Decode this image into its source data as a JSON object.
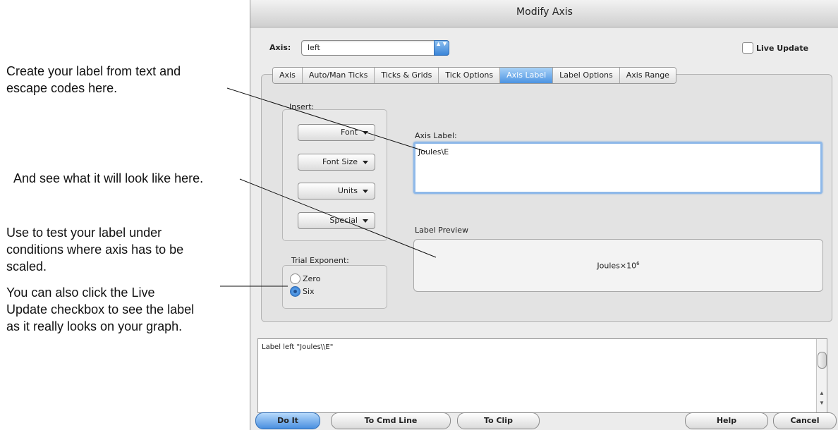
{
  "annotations": {
    "create_line1": "Create your label from text and",
    "create_line2": "escape codes here.",
    "see": "And see what it will look like here.",
    "use_line1": "Use to test your label under",
    "use_line2": "conditions where axis has to be",
    "use_line3": "scaled.",
    "live_line1": "You can also click the Live",
    "live_line2": "Update checkbox to see the label",
    "live_line3": "as it really looks on your graph."
  },
  "window": {
    "title": "Modify Axis"
  },
  "axis_selector": {
    "label": "Axis:",
    "value": "left",
    "arrows": "▲▼"
  },
  "live_update": {
    "label": "Live Update",
    "checked": false
  },
  "tabs": [
    {
      "label": "Axis"
    },
    {
      "label": "Auto/Man Ticks"
    },
    {
      "label": "Ticks & Grids"
    },
    {
      "label": "Tick Options"
    },
    {
      "label": "Axis Label",
      "selected": true
    },
    {
      "label": "Label Options"
    },
    {
      "label": "Axis Range"
    }
  ],
  "insert": {
    "label": "Insert:",
    "buttons": [
      {
        "label": "Font"
      },
      {
        "label": "Font Size"
      },
      {
        "label": "Units"
      },
      {
        "label": "Special"
      }
    ]
  },
  "axis_label": {
    "title": "Axis Label:",
    "value": "Joules\\E"
  },
  "preview": {
    "title": "Label Preview",
    "text": "Joules×10",
    "exponent": "6"
  },
  "trial_exponent": {
    "label": "Trial Exponent:",
    "options": [
      {
        "label": "Zero",
        "selected": false
      },
      {
        "label": "Six",
        "selected": true
      }
    ]
  },
  "command": {
    "text": "Label left \"Joules\\\\E\""
  },
  "buttons": {
    "do_it": "Do It",
    "to_cmd_line": "To Cmd Line",
    "to_clip": "To Clip",
    "help": "Help",
    "cancel": "Cancel"
  },
  "colors": {
    "accent": "#3a84d8",
    "tab_selected": "#4b93e2",
    "window_bg": "#ececec"
  }
}
